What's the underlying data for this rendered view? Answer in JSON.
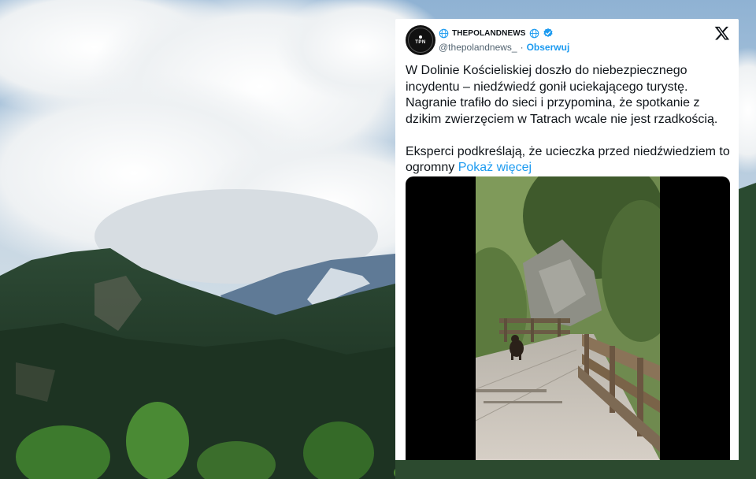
{
  "tweet": {
    "name": "THEPOLANDNEWS",
    "handle": "@thepolandnews_",
    "separator": "·",
    "follow_label": "Obserwuj",
    "avatar_text": "TPN",
    "body_text": "W Dolinie Kościeliskiej doszło do niebezpiecznego incydentu – niedźwiedź gonił uciekającego turystę. Nagranie trafiło do sieci i przypomina, że spotkanie z dzikim zwierzęciem w Tatrach wcale nie jest rzadkością.\n\nEksperci podkreślają, że ucieczka przed niedźwiedziem to ogromny ",
    "show_more_label": "Pokaż więcej"
  },
  "icons": {
    "globe": "globe-icon",
    "verified": "verified-badge-icon",
    "close": "x-logo-icon"
  },
  "colors": {
    "link": "#1d9bf0",
    "text": "#0f1419",
    "muted": "#536471"
  }
}
